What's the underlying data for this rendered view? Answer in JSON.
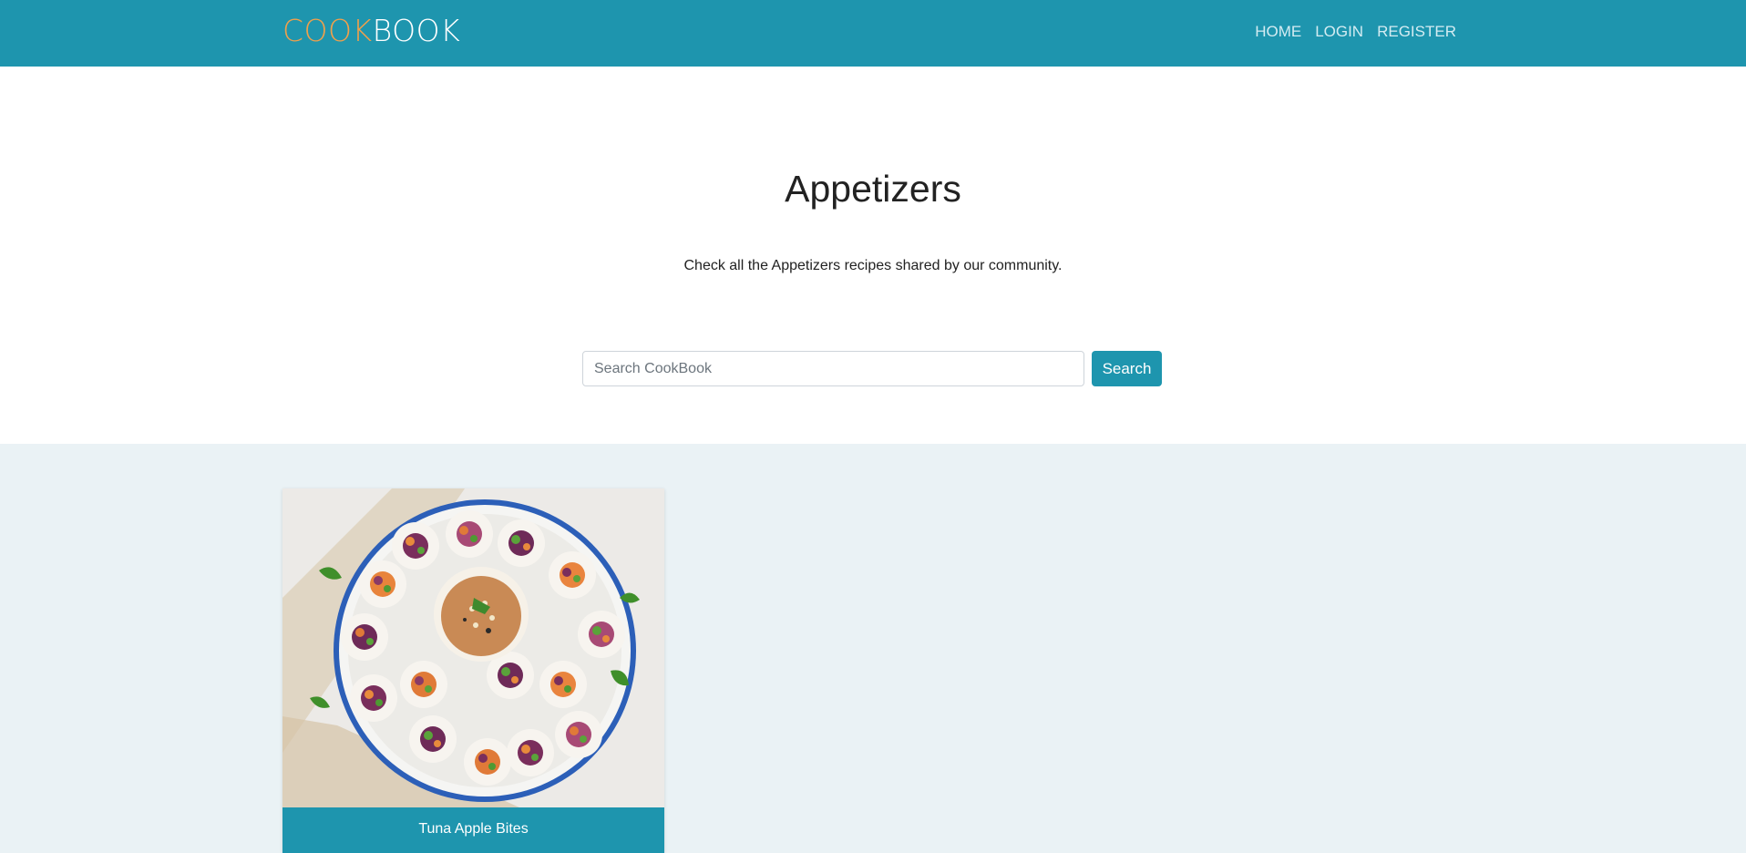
{
  "nav": {
    "brand_part1": "COOK",
    "brand_part2": "BOOK",
    "links": [
      "HOME",
      "LOGIN",
      "REGISTER"
    ]
  },
  "hero": {
    "title": "Appetizers",
    "subtitle": "Check all the Appetizers recipes shared by our community."
  },
  "search": {
    "placeholder": "Search CookBook",
    "value": "",
    "button_label": "Search"
  },
  "recipes": [
    {
      "title": "Tuna Apple Bites",
      "image": "spring-rolls-with-dipping-sauce-photo"
    }
  ],
  "colors": {
    "primary": "#1e95ae",
    "brand_accent": "#f0a04b",
    "section_bg": "#eaf2f5"
  }
}
